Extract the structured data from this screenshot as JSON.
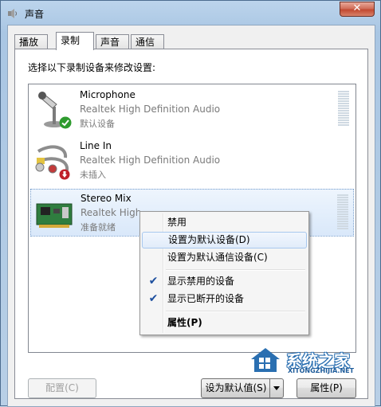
{
  "window": {
    "title": "声音",
    "close_label": "✕"
  },
  "tabs": [
    {
      "label": "播放",
      "active": false
    },
    {
      "label": "录制",
      "active": true
    },
    {
      "label": "声音",
      "active": false
    },
    {
      "label": "通信",
      "active": false
    }
  ],
  "instruction": "选择以下录制设备来修改设置:",
  "devices": [
    {
      "name": "Microphone",
      "driver": "Realtek High Definition Audio",
      "status": "默认设备",
      "icon": "microphone-icon",
      "badge": "default-check-icon",
      "selected": false
    },
    {
      "name": "Line In",
      "driver": "Realtek High Definition Audio",
      "status": "未插入",
      "icon": "line-in-icon",
      "badge": "unplugged-icon",
      "selected": false
    },
    {
      "name": "Stereo Mix",
      "driver": "Realtek High",
      "status": "准备就绪",
      "icon": "sound-card-icon",
      "badge": "",
      "selected": true
    }
  ],
  "context_menu": [
    {
      "label": "禁用",
      "checked": false,
      "bold": false,
      "hover": false
    },
    {
      "label": "设置为默认设备(D)",
      "checked": false,
      "bold": false,
      "hover": true
    },
    {
      "label": "设置为默认通信设备(C)",
      "checked": false,
      "bold": false,
      "hover": false
    },
    {
      "label": "显示禁用的设备",
      "checked": true,
      "bold": false,
      "hover": false
    },
    {
      "label": "显示已断开的设备",
      "checked": true,
      "bold": false,
      "hover": false
    },
    {
      "label": "属性(P)",
      "checked": false,
      "bold": true,
      "hover": false
    }
  ],
  "buttons": {
    "configure": "配置(C)",
    "set_default": "设为默认值(S)",
    "properties": "属性(P)"
  },
  "watermark": {
    "text": "系统之家",
    "sub": "XITONGZHIJIA.NET"
  },
  "colors": {
    "accent": "#2a6fb1",
    "check_green": "#2e9b2e",
    "unplugged_red": "#c0202a"
  }
}
